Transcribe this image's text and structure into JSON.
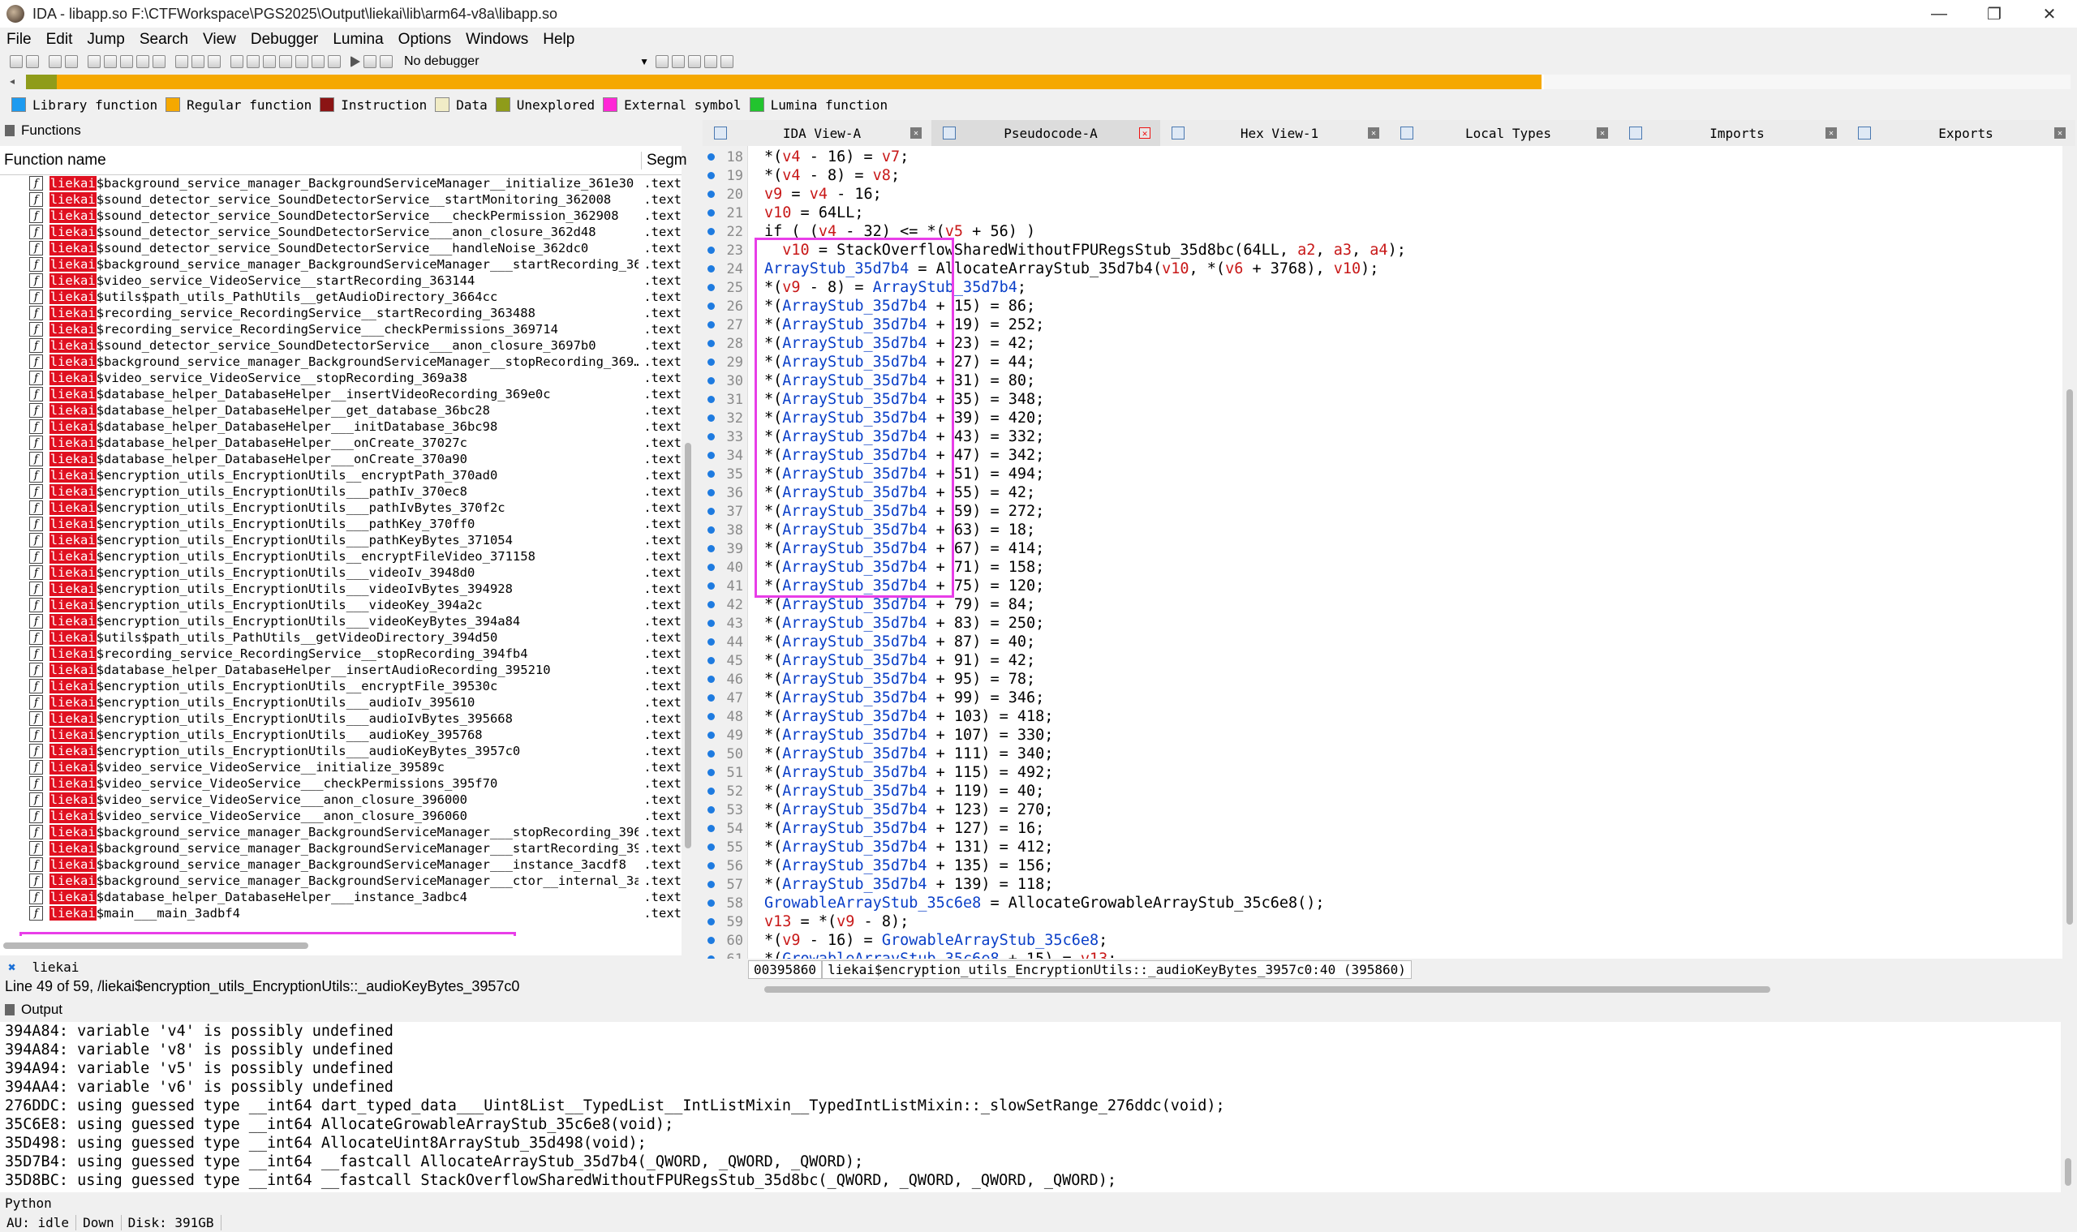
{
  "window": {
    "title": "IDA - libapp.so F:\\CTFWorkspace\\PGS2025\\Output\\liekai\\lib\\arm64-v8a\\libapp.so",
    "controls": [
      "—",
      "❐",
      "✕"
    ]
  },
  "menu": [
    "File",
    "Edit",
    "Jump",
    "Search",
    "View",
    "Debugger",
    "Lumina",
    "Options",
    "Windows",
    "Help"
  ],
  "toolbar": {
    "debugger": "No debugger"
  },
  "legend": [
    {
      "label": "Library function",
      "color": "#1d9bf0"
    },
    {
      "label": "Regular function",
      "color": "#f5a800"
    },
    {
      "label": "Instruction",
      "color": "#8b1414"
    },
    {
      "label": "Data",
      "color": "#f1ecc6"
    },
    {
      "label": "Unexplored",
      "color": "#8f9c1a"
    },
    {
      "label": "External symbol",
      "color": "#ff27d6"
    },
    {
      "label": "Lumina function",
      "color": "#22c42e"
    }
  ],
  "functions": {
    "panel_title": "Functions",
    "col_name": "Function name",
    "col_segment": "Segm",
    "rows": [
      {
        "prefix": "liekai",
        "name": "$background_service_manager_BackgroundServiceManager__initialize_361e30",
        "seg": ".text"
      },
      {
        "prefix": "liekai",
        "name": "$sound_detector_service_SoundDetectorService__startMonitoring_362008",
        "seg": ".text"
      },
      {
        "prefix": "liekai",
        "name": "$sound_detector_service_SoundDetectorService___checkPermission_362908",
        "seg": ".text"
      },
      {
        "prefix": "liekai",
        "name": "$sound_detector_service_SoundDetectorService___anon_closure_362d48",
        "seg": ".text"
      },
      {
        "prefix": "liekai",
        "name": "$sound_detector_service_SoundDetectorService___handleNoise_362dc0",
        "seg": ".text"
      },
      {
        "prefix": "liekai",
        "name": "$background_service_manager_BackgroundServiceManager___startRecording_36…",
        "seg": ".text"
      },
      {
        "prefix": "liekai",
        "name": "$video_service_VideoService__startRecording_363144",
        "seg": ".text"
      },
      {
        "prefix": "liekai",
        "name": "$utils$path_utils_PathUtils__getAudioDirectory_3664cc",
        "seg": ".text"
      },
      {
        "prefix": "liekai",
        "name": "$recording_service_RecordingService__startRecording_363488",
        "seg": ".text"
      },
      {
        "prefix": "liekai",
        "name": "$recording_service_RecordingService___checkPermissions_369714",
        "seg": ".text"
      },
      {
        "prefix": "liekai",
        "name": "$sound_detector_service_SoundDetectorService___anon_closure_3697b0",
        "seg": ".text"
      },
      {
        "prefix": "liekai",
        "name": "$background_service_manager_BackgroundServiceManager__stopRecording_369…",
        "seg": ".text"
      },
      {
        "prefix": "liekai",
        "name": "$video_service_VideoService__stopRecording_369a38",
        "seg": ".text"
      },
      {
        "prefix": "liekai",
        "name": "$database_helper_DatabaseHelper__insertVideoRecording_369e0c",
        "seg": ".text"
      },
      {
        "prefix": "liekai",
        "name": "$database_helper_DatabaseHelper__get_database_36bc28",
        "seg": ".text"
      },
      {
        "prefix": "liekai",
        "name": "$database_helper_DatabaseHelper___initDatabase_36bc98",
        "seg": ".text"
      },
      {
        "prefix": "liekai",
        "name": "$database_helper_DatabaseHelper___onCreate_37027c",
        "seg": ".text"
      },
      {
        "prefix": "liekai",
        "name": "$database_helper_DatabaseHelper___onCreate_370a90",
        "seg": ".text"
      },
      {
        "prefix": "liekai",
        "name": "$encryption_utils_EncryptionUtils__encryptPath_370ad0",
        "seg": ".text"
      },
      {
        "prefix": "liekai",
        "name": "$encryption_utils_EncryptionUtils___pathIv_370ec8",
        "seg": ".text"
      },
      {
        "prefix": "liekai",
        "name": "$encryption_utils_EncryptionUtils___pathIvBytes_370f2c",
        "seg": ".text"
      },
      {
        "prefix": "liekai",
        "name": "$encryption_utils_EncryptionUtils___pathKey_370ff0",
        "seg": ".text"
      },
      {
        "prefix": "liekai",
        "name": "$encryption_utils_EncryptionUtils___pathKeyBytes_371054",
        "seg": ".text"
      },
      {
        "prefix": "liekai",
        "name": "$encryption_utils_EncryptionUtils__encryptFileVideo_371158",
        "seg": ".text"
      },
      {
        "prefix": "liekai",
        "name": "$encryption_utils_EncryptionUtils___videoIv_3948d0",
        "seg": ".text"
      },
      {
        "prefix": "liekai",
        "name": "$encryption_utils_EncryptionUtils___videoIvBytes_394928",
        "seg": ".text"
      },
      {
        "prefix": "liekai",
        "name": "$encryption_utils_EncryptionUtils___videoKey_394a2c",
        "seg": ".text"
      },
      {
        "prefix": "liekai",
        "name": "$encryption_utils_EncryptionUtils___videoKeyBytes_394a84",
        "seg": ".text"
      },
      {
        "prefix": "liekai",
        "name": "$utils$path_utils_PathUtils__getVideoDirectory_394d50",
        "seg": ".text"
      },
      {
        "prefix": "liekai",
        "name": "$recording_service_RecordingService__stopRecording_394fb4",
        "seg": ".text"
      },
      {
        "prefix": "liekai",
        "name": "$database_helper_DatabaseHelper__insertAudioRecording_395210",
        "seg": ".text"
      },
      {
        "prefix": "liekai",
        "name": "$encryption_utils_EncryptionUtils__encryptFile_39530c",
        "seg": ".text"
      },
      {
        "prefix": "liekai",
        "name": "$encryption_utils_EncryptionUtils___audioIv_395610",
        "seg": ".text"
      },
      {
        "prefix": "liekai",
        "name": "$encryption_utils_EncryptionUtils___audioIvBytes_395668",
        "seg": ".text"
      },
      {
        "prefix": "liekai",
        "name": "$encryption_utils_EncryptionUtils___audioKey_395768",
        "seg": ".text"
      },
      {
        "prefix": "liekai",
        "name": "$encryption_utils_EncryptionUtils___audioKeyBytes_3957c0",
        "seg": ".text"
      },
      {
        "prefix": "liekai",
        "name": "$video_service_VideoService__initialize_39589c",
        "seg": ".text"
      },
      {
        "prefix": "liekai",
        "name": "$video_service_VideoService___checkPermissions_395f70",
        "seg": ".text"
      },
      {
        "prefix": "liekai",
        "name": "$video_service_VideoService___anon_closure_396000",
        "seg": ".text"
      },
      {
        "prefix": "liekai",
        "name": "$video_service_VideoService___anon_closure_396060",
        "seg": ".text"
      },
      {
        "prefix": "liekai",
        "name": "$background_service_manager_BackgroundServiceManager___stopRecording_396…",
        "seg": ".text"
      },
      {
        "prefix": "liekai",
        "name": "$background_service_manager_BackgroundServiceManager___startRecording_39…",
        "seg": ".text"
      },
      {
        "prefix": "liekai",
        "name": "$background_service_manager_BackgroundServiceManager___instance_3acdf8",
        "seg": ".text"
      },
      {
        "prefix": "liekai",
        "name": "$background_service_manager_BackgroundServiceManager___ctor__internal_3ac…",
        "seg": ".text"
      },
      {
        "prefix": "liekai",
        "name": "$database_helper_DatabaseHelper___instance_3adbc4",
        "seg": ".text"
      },
      {
        "prefix": "liekai",
        "name": "$main___main_3adbf4",
        "seg": ".text"
      }
    ],
    "filter_text": "liekai",
    "status": "Line 49 of 59, /liekai$encryption_utils_EncryptionUtils::_audioKeyBytes_3957c0"
  },
  "tabs": [
    {
      "label": "IDA View-A",
      "close": "✕"
    },
    {
      "label": "Pseudocode-A",
      "close": "✕"
    },
    {
      "label": "Hex View-1",
      "close": "✕"
    },
    {
      "label": "Local Types",
      "close": "✕"
    },
    {
      "label": "Imports",
      "close": "✕"
    },
    {
      "label": "Exports",
      "close": "✕"
    }
  ],
  "pseudocode": {
    "lines": [
      {
        "n": "18",
        "text": "*(v4 - 16) = v7;"
      },
      {
        "n": "19",
        "text": "*(v4 - 8) = v8;"
      },
      {
        "n": "20",
        "text": "v9 = v4 - 16;"
      },
      {
        "n": "21",
        "text": "v10 = 64LL;"
      },
      {
        "n": "22",
        "text": "if ( (v4 - 32) <= *(v5 + 56) )"
      },
      {
        "n": "23",
        "text": "  v10 = StackOverflowSharedWithoutFPURegsStub_35d8bc(64LL, a2, a3, a4);"
      },
      {
        "n": "24",
        "text": "ArrayStub_35d7b4 = AllocateArrayStub_35d7b4(v10, *(v6 + 3768), v10);"
      },
      {
        "n": "25",
        "text": "*(v9 - 8) = ArrayStub_35d7b4;"
      },
      {
        "n": "26",
        "text": "*(ArrayStub_35d7b4 + 15) = 86;"
      },
      {
        "n": "27",
        "text": "*(ArrayStub_35d7b4 + 19) = 252;"
      },
      {
        "n": "28",
        "text": "*(ArrayStub_35d7b4 + 23) = 42;"
      },
      {
        "n": "29",
        "text": "*(ArrayStub_35d7b4 + 27) = 44;"
      },
      {
        "n": "30",
        "text": "*(ArrayStub_35d7b4 + 31) = 80;"
      },
      {
        "n": "31",
        "text": "*(ArrayStub_35d7b4 + 35) = 348;"
      },
      {
        "n": "32",
        "text": "*(ArrayStub_35d7b4 + 39) = 420;"
      },
      {
        "n": "33",
        "text": "*(ArrayStub_35d7b4 + 43) = 332;"
      },
      {
        "n": "34",
        "text": "*(ArrayStub_35d7b4 + 47) = 342;"
      },
      {
        "n": "35",
        "text": "*(ArrayStub_35d7b4 + 51) = 494;"
      },
      {
        "n": "36",
        "text": "*(ArrayStub_35d7b4 + 55) = 42;"
      },
      {
        "n": "37",
        "text": "*(ArrayStub_35d7b4 + 59) = 272;"
      },
      {
        "n": "38",
        "text": "*(ArrayStub_35d7b4 + 63) = 18;"
      },
      {
        "n": "39",
        "text": "*(ArrayStub_35d7b4 + 67) = 414;"
      },
      {
        "n": "40",
        "text": "*(ArrayStub_35d7b4 + 71) = 158;"
      },
      {
        "n": "41",
        "text": "*(ArrayStub_35d7b4 + 75) = 120;"
      },
      {
        "n": "42",
        "text": "*(ArrayStub_35d7b4 + 79) = 84;"
      },
      {
        "n": "43",
        "text": "*(ArrayStub_35d7b4 + 83) = 250;"
      },
      {
        "n": "44",
        "text": "*(ArrayStub_35d7b4 + 87) = 40;"
      },
      {
        "n": "45",
        "text": "*(ArrayStub_35d7b4 + 91) = 42;"
      },
      {
        "n": "46",
        "text": "*(ArrayStub_35d7b4 + 95) = 78;"
      },
      {
        "n": "47",
        "text": "*(ArrayStub_35d7b4 + 99) = 346;"
      },
      {
        "n": "48",
        "text": "*(ArrayStub_35d7b4 + 103) = 418;"
      },
      {
        "n": "49",
        "text": "*(ArrayStub_35d7b4 + 107) = 330;"
      },
      {
        "n": "50",
        "text": "*(ArrayStub_35d7b4 + 111) = 340;"
      },
      {
        "n": "51",
        "text": "*(ArrayStub_35d7b4 + 115) = 492;"
      },
      {
        "n": "52",
        "text": "*(ArrayStub_35d7b4 + 119) = 40;"
      },
      {
        "n": "53",
        "text": "*(ArrayStub_35d7b4 + 123) = 270;"
      },
      {
        "n": "54",
        "text": "*(ArrayStub_35d7b4 + 127) = 16;"
      },
      {
        "n": "55",
        "text": "*(ArrayStub_35d7b4 + 131) = 412;"
      },
      {
        "n": "56",
        "text": "*(ArrayStub_35d7b4 + 135) = 156;"
      },
      {
        "n": "57",
        "text": "*(ArrayStub_35d7b4 + 139) = 118;"
      },
      {
        "n": "58",
        "text": "GrowableArrayStub_35c6e8 = AllocateGrowableArrayStub_35c6e8();"
      },
      {
        "n": "59",
        "text": "v13 = *(v9 - 8);"
      },
      {
        "n": "60",
        "text": "*(v9 - 16) = GrowableArrayStub_35c6e8;"
      },
      {
        "n": "61",
        "text": "*(GrowableArrayStub_35c6e8 + 15) = v13;"
      }
    ],
    "status_addr": "00395860",
    "status_loc": "liekai$encryption_utils_EncryptionUtils::_audioKeyBytes_3957c0:40 (395860)"
  },
  "output": {
    "panel_title": "Output",
    "lines": [
      "394A84: variable 'v4' is possibly undefined",
      "394A84: variable 'v8' is possibly undefined",
      "394A94: variable 'v5' is possibly undefined",
      "394AA4: variable 'v6' is possibly undefined",
      "276DDC: using guessed type __int64 dart_typed_data___Uint8List__TypedList__IntListMixin__TypedIntListMixin::_slowSetRange_276ddc(void);",
      "35C6E8: using guessed type __int64 AllocateGrowableArrayStub_35c6e8(void);",
      "35D498: using guessed type __int64 AllocateUint8ArrayStub_35d498(void);",
      "35D7B4: using guessed type __int64 __fastcall AllocateArrayStub_35d7b4(_QWORD, _QWORD, _QWORD);",
      "35D8BC: using guessed type __int64 __fastcall StackOverflowSharedWithoutFPURegsStub_35d8bc(_QWORD, _QWORD, _QWORD, _QWORD);"
    ],
    "python_label": "Python"
  },
  "statusbar": [
    "AU:  idle",
    "Down",
    "Disk: 391GB"
  ]
}
